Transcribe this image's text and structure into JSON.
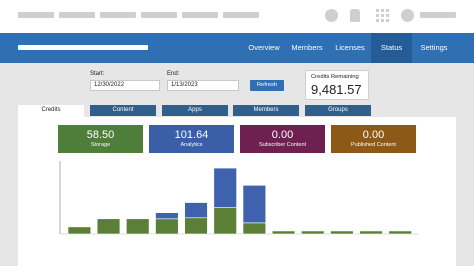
{
  "colors": {
    "nav": "#2f6fb3",
    "nav_active": "#245c98",
    "tab_inactive": "#2f5f8a",
    "storage": "#4f7d3a",
    "analytics": "#3a5ea7",
    "subscriber": "#6e2150",
    "published": "#8c5a16",
    "bar_green": "#5b7f36",
    "bar_blue": "#3e62ad"
  },
  "nav": {
    "items": [
      {
        "label": "Overview",
        "icon": ""
      },
      {
        "label": "Members",
        "icon": ""
      },
      {
        "label": "Licenses",
        "icon": ""
      },
      {
        "label": "Status",
        "icon": ""
      },
      {
        "label": "Settings",
        "icon": ""
      }
    ],
    "active": "Status"
  },
  "filters": {
    "start_label": "Start:",
    "start_value": "12/30/2022",
    "end_label": "End:",
    "end_value": "1/13/2023",
    "refresh_label": "Refresh"
  },
  "credits": {
    "label": "Credits Remaining",
    "value": "9,481.57"
  },
  "tabs": [
    {
      "label": "Credits"
    },
    {
      "label": "Content"
    },
    {
      "label": "Apps"
    },
    {
      "label": "Members"
    },
    {
      "label": "Groups"
    }
  ],
  "stats": [
    {
      "value": "58.50",
      "caption": "Storage",
      "color": "#4f7d3a"
    },
    {
      "value": "101.64",
      "caption": "Analytics",
      "color": "#3a5ea7"
    },
    {
      "value": "0.00",
      "caption": "Subscriber Content",
      "color": "#6e2150"
    },
    {
      "value": "0.00",
      "caption": "Published Content",
      "color": "#8c5a16"
    }
  ],
  "chart_data": {
    "type": "bar",
    "stacked": true,
    "categories": [
      "",
      "",
      "",
      "",
      "",
      "",
      "",
      "",
      "",
      "",
      "",
      ""
    ],
    "series": [
      {
        "values": [
          7,
          15,
          15,
          15,
          16,
          26,
          11,
          3,
          3,
          3,
          3,
          3
        ]
      },
      {
        "values": [
          0,
          0,
          0,
          6,
          15,
          39,
          37,
          0,
          0,
          0,
          0,
          0
        ]
      }
    ],
    "ylim": [
      0,
      70
    ]
  }
}
